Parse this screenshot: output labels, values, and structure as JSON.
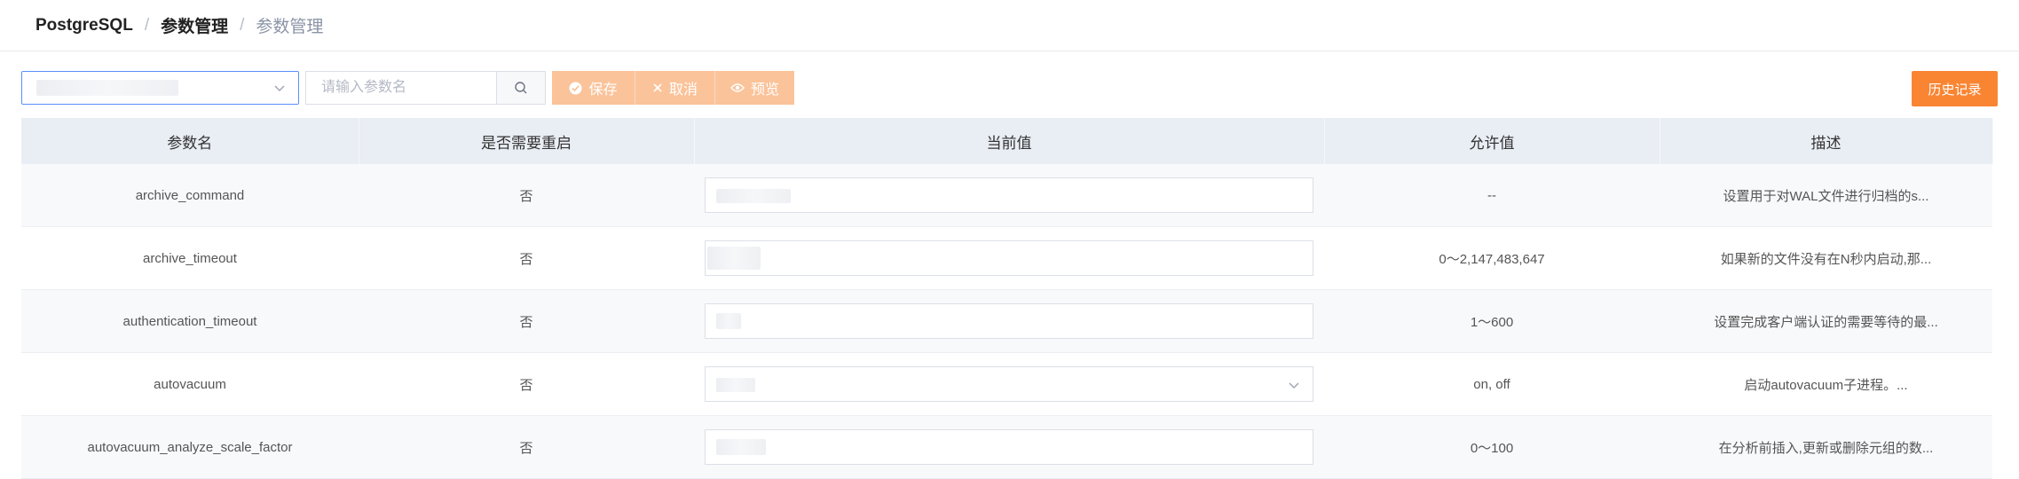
{
  "breadcrumb": {
    "items": [
      "PostgreSQL",
      "参数管理",
      "参数管理"
    ],
    "separator": "/"
  },
  "toolbar": {
    "search_placeholder": "请输入参数名",
    "save_label": "保存",
    "cancel_label": "取消",
    "preview_label": "预览",
    "history_label": "历史记录"
  },
  "table": {
    "headers": [
      "参数名",
      "是否需要重启",
      "当前值",
      "允许值",
      "描述"
    ],
    "rows": [
      {
        "name": "archive_command",
        "restart": "否",
        "allowed": "--",
        "desc": "设置用于对WAL文件进行归档的s...",
        "input_type": "text"
      },
      {
        "name": "archive_timeout",
        "restart": "否",
        "allowed": "0～2,147,483,647",
        "desc": "如果新的文件没有在N秒内启动,那...",
        "input_type": "text"
      },
      {
        "name": "authentication_timeout",
        "restart": "否",
        "allowed": "1～600",
        "desc": "设置完成客户端认证的需要等待的最...",
        "input_type": "text"
      },
      {
        "name": "autovacuum",
        "restart": "否",
        "allowed": "on, off",
        "desc": "启动autovacuum子进程。...",
        "input_type": "select"
      },
      {
        "name": "autovacuum_analyze_scale_factor",
        "restart": "否",
        "allowed": "0～100",
        "desc": "在分析前插入,更新或删除元组的数...",
        "input_type": "text"
      }
    ]
  },
  "colors": {
    "accent_blue": "#5b8ff9",
    "orange": "#f98533",
    "orange_disabled": "#fbc39a",
    "header_bg": "#e9edf4"
  }
}
